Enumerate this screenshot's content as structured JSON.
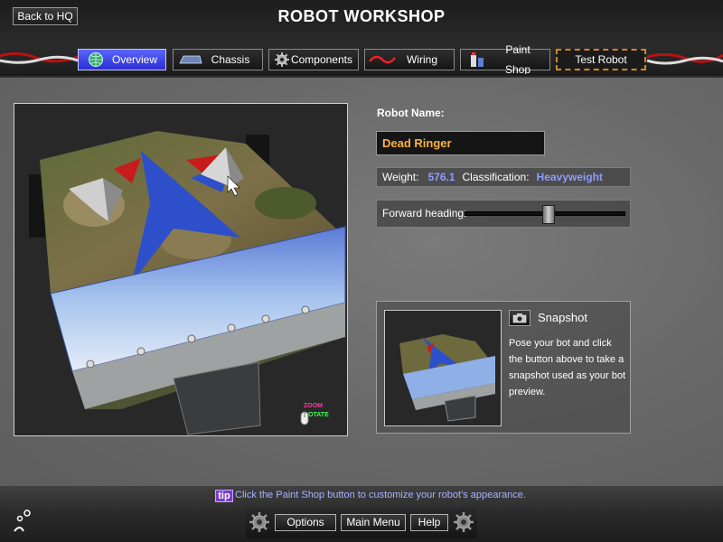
{
  "header": {
    "title": "ROBOT WORKSHOP",
    "back_label": "Back to HQ",
    "tabs": [
      {
        "label": "Overview",
        "icon": "globe-icon",
        "active": true
      },
      {
        "label": "Chassis",
        "icon": "chassis-icon"
      },
      {
        "label": "Components",
        "icon": "gear-icon"
      },
      {
        "label": "Wiring",
        "icon": "wire-icon"
      },
      {
        "label": "Paint Shop",
        "icon": "paint-cans-icon"
      },
      {
        "label": "Test Robot",
        "icon": ""
      }
    ]
  },
  "viewport": {
    "hint_zoom": "ZOOM",
    "hint_rotate": "ROTATE",
    "hint_icon": "mouse-icon"
  },
  "robot": {
    "name_label": "Robot Name:",
    "name": "Dead Ringer",
    "weight_label": "Weight:",
    "weight": "576.1",
    "class_label": "Classification:",
    "class": "Heavyweight",
    "heading_label": "Forward heading:",
    "heading_fraction": 0.52
  },
  "snapshot": {
    "title": "Snapshot",
    "icon": "camera-icon",
    "text": "Pose your bot and click the button above to take a snapshot used as your bot preview."
  },
  "footer": {
    "tip_badge": "tip",
    "tip_text": "Click the Paint Shop button to customize your robot's appearance.",
    "options_label": "Options",
    "main_menu_label": "Main Menu",
    "help_label": "Help"
  },
  "colors": {
    "accent_orange": "#ffb13b",
    "value_blue": "#8f9bff",
    "active_tab": "#3a40e0",
    "tip_purple": "#7c3ec9"
  }
}
